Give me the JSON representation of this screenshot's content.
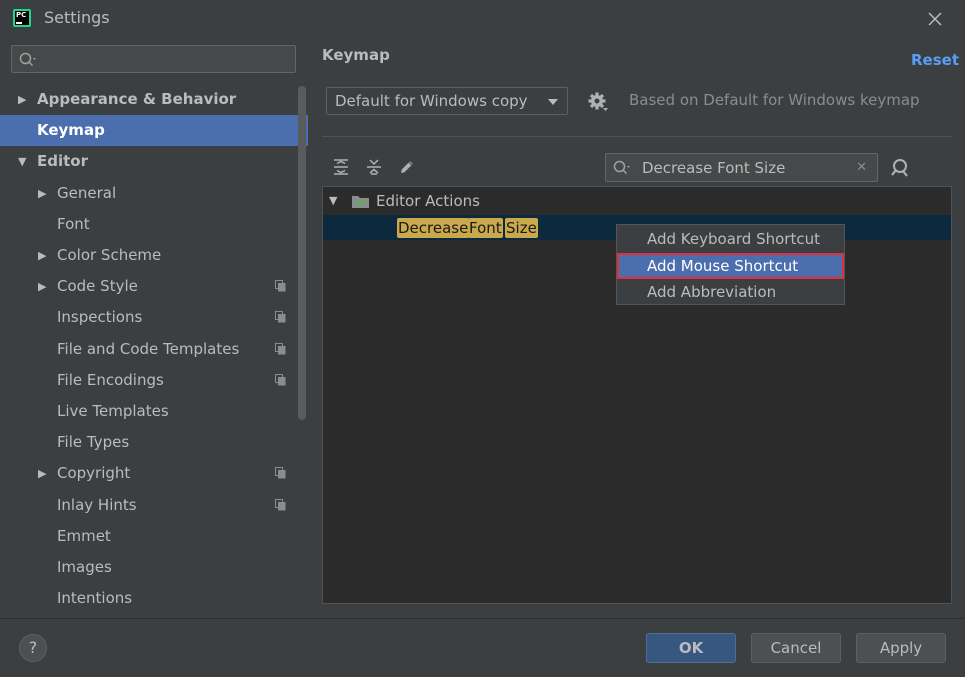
{
  "window": {
    "title": "Settings",
    "logo_text": "PC"
  },
  "sidebar": {
    "search": {
      "placeholder": ""
    },
    "items": [
      {
        "label": "Appearance & Behavior",
        "level": 0,
        "expandable": true,
        "expanded": false,
        "bold": true
      },
      {
        "label": "Keymap",
        "level": 0,
        "expandable": false,
        "bold": true,
        "selected": true
      },
      {
        "label": "Editor",
        "level": 0,
        "expandable": true,
        "expanded": true,
        "bold": true
      },
      {
        "label": "General",
        "level": 1,
        "expandable": true,
        "expanded": false
      },
      {
        "label": "Font",
        "level": 1,
        "expandable": false
      },
      {
        "label": "Color Scheme",
        "level": 1,
        "expandable": true,
        "expanded": false
      },
      {
        "label": "Code Style",
        "level": 1,
        "expandable": true,
        "expanded": false,
        "project_icon": true
      },
      {
        "label": "Inspections",
        "level": 1,
        "expandable": false,
        "project_icon": true
      },
      {
        "label": "File and Code Templates",
        "level": 1,
        "expandable": false,
        "project_icon": true
      },
      {
        "label": "File Encodings",
        "level": 1,
        "expandable": false,
        "project_icon": true
      },
      {
        "label": "Live Templates",
        "level": 1,
        "expandable": false
      },
      {
        "label": "File Types",
        "level": 1,
        "expandable": false
      },
      {
        "label": "Copyright",
        "level": 1,
        "expandable": true,
        "expanded": false,
        "project_icon": true
      },
      {
        "label": "Inlay Hints",
        "level": 1,
        "expandable": false,
        "project_icon": true
      },
      {
        "label": "Emmet",
        "level": 1,
        "expandable": false
      },
      {
        "label": "Images",
        "level": 1,
        "expandable": false
      },
      {
        "label": "Intentions",
        "level": 1,
        "expandable": false
      }
    ]
  },
  "panel": {
    "title": "Keymap",
    "reset_label": "Reset",
    "keymap_select": {
      "value": "Default for Windows copy"
    },
    "based_on": "Based on Default for Windows keymap",
    "filter": {
      "value": "Decrease Font Size"
    },
    "tree": {
      "group": "Editor Actions",
      "action_words": [
        "Decrease",
        "Font",
        "Size"
      ]
    }
  },
  "context_menu": {
    "items": [
      {
        "label": "Add Keyboard Shortcut",
        "active": false
      },
      {
        "label": "Add Mouse Shortcut",
        "active": true
      },
      {
        "label": "Add Abbreviation",
        "active": false
      }
    ]
  },
  "footer": {
    "help_label": "?",
    "ok_label": "OK",
    "cancel_label": "Cancel",
    "apply_label": "Apply"
  },
  "colors": {
    "background": "#3c3f41",
    "selection": "#4b6eaf",
    "link": "#589df6",
    "highlight": "#c9a94b",
    "menu_focus_border": "#e0303b"
  }
}
